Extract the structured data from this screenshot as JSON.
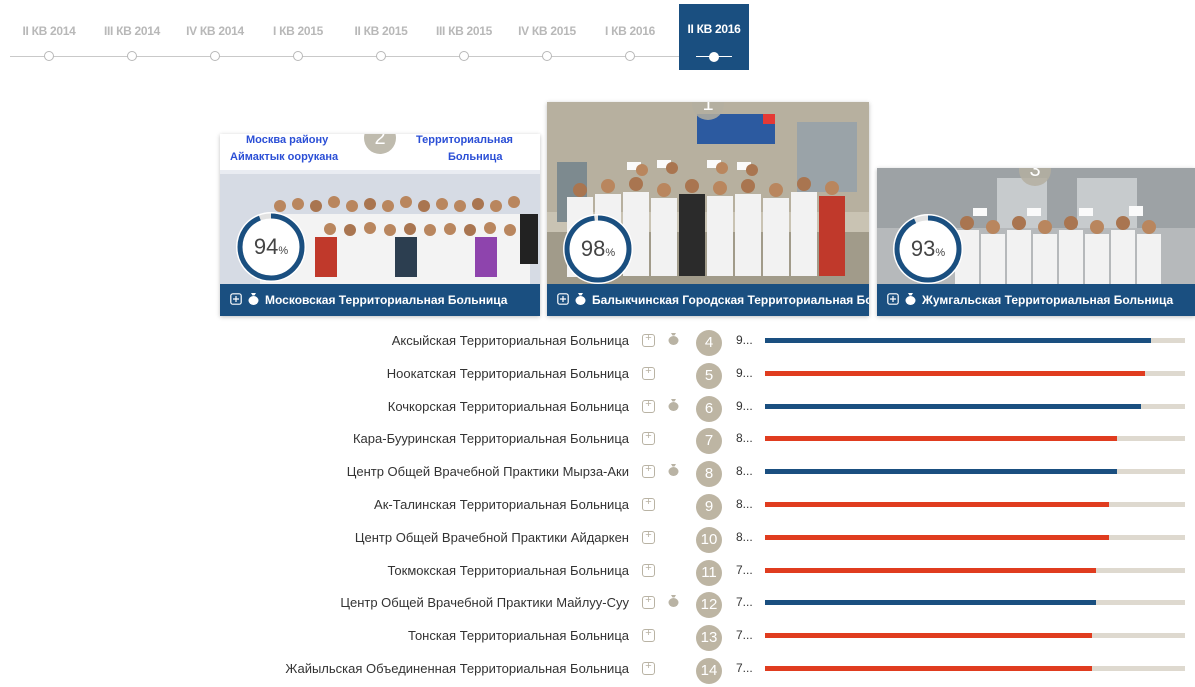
{
  "colors": {
    "primary": "#1a4f80",
    "secondary": "#e03c1f",
    "track": "#ded9cf",
    "badge": "#bdb5a3"
  },
  "timeline": {
    "items": [
      {
        "label": "II КВ 2014"
      },
      {
        "label": "III КВ 2014"
      },
      {
        "label": "IV КВ 2014"
      },
      {
        "label": "I КВ 2015"
      },
      {
        "label": "II КВ 2015"
      },
      {
        "label": "III КВ 2015"
      },
      {
        "label": "IV КВ 2015"
      },
      {
        "label": "I КВ 2016"
      }
    ],
    "active": {
      "label": "II КВ 2016"
    }
  },
  "cards": [
    {
      "rank": "2",
      "percent": "94",
      "percent_unit": "%",
      "percent_value": 94,
      "name": "Московская Территориальная Больница",
      "icons": [
        "hospital-icon",
        "money-bag-icon"
      ],
      "sign": {
        "left1": "Москва району",
        "left2": "Аймактык оорукана",
        "right1": "Территориальная",
        "right2": "Больница"
      }
    },
    {
      "rank": "1",
      "percent": "98",
      "percent_unit": "%",
      "percent_value": 98,
      "name": "Балыкчинская Городская Территориальная Больница",
      "icons": [
        "hospital-icon",
        "money-bag-icon"
      ]
    },
    {
      "rank": "3",
      "percent": "93",
      "percent_unit": "%",
      "percent_value": 93,
      "name": "Жумгальская Территориальная Больница",
      "icons": [
        "hospital-icon",
        "money-bag-icon"
      ]
    }
  ],
  "list": [
    {
      "name": "Аксыйская Территориальная Больница",
      "rank": "4",
      "score": "9...",
      "fill": 0.92,
      "color": "primary",
      "money": true
    },
    {
      "name": "Ноокатская Территориальная Больница",
      "rank": "5",
      "score": "9...",
      "fill": 0.905,
      "color": "secondary",
      "money": false
    },
    {
      "name": "Кочкорская Территориальная Больница",
      "rank": "6",
      "score": "9...",
      "fill": 0.895,
      "color": "primary",
      "money": true
    },
    {
      "name": "Кара-Бууринская Территориальная Больница",
      "rank": "7",
      "score": "8...",
      "fill": 0.838,
      "color": "secondary",
      "money": false
    },
    {
      "name": "Центр Общей Врачебной Практики Мырза-Аки",
      "rank": "8",
      "score": "8...",
      "fill": 0.838,
      "color": "primary",
      "money": true
    },
    {
      "name": "Ак-Талинская Территориальная Больница",
      "rank": "9",
      "score": "8...",
      "fill": 0.818,
      "color": "secondary",
      "money": false
    },
    {
      "name": "Центр Общей Врачебной Практики Айдаркен",
      "rank": "10",
      "score": "8...",
      "fill": 0.818,
      "color": "secondary",
      "money": false
    },
    {
      "name": "Токмокская Территориальная Больница",
      "rank": "11",
      "score": "7...",
      "fill": 0.788,
      "color": "secondary",
      "money": false
    },
    {
      "name": "Центр Общей Врачебной Практики Майлуу-Суу",
      "rank": "12",
      "score": "7...",
      "fill": 0.788,
      "color": "primary",
      "money": true
    },
    {
      "name": "Тонская Территориальная Больница",
      "rank": "13",
      "score": "7...",
      "fill": 0.778,
      "color": "secondary",
      "money": false
    },
    {
      "name": "Жайыльская Объединенная Территориальная Больница",
      "rank": "14",
      "score": "7...",
      "fill": 0.778,
      "color": "secondary",
      "money": false
    }
  ]
}
